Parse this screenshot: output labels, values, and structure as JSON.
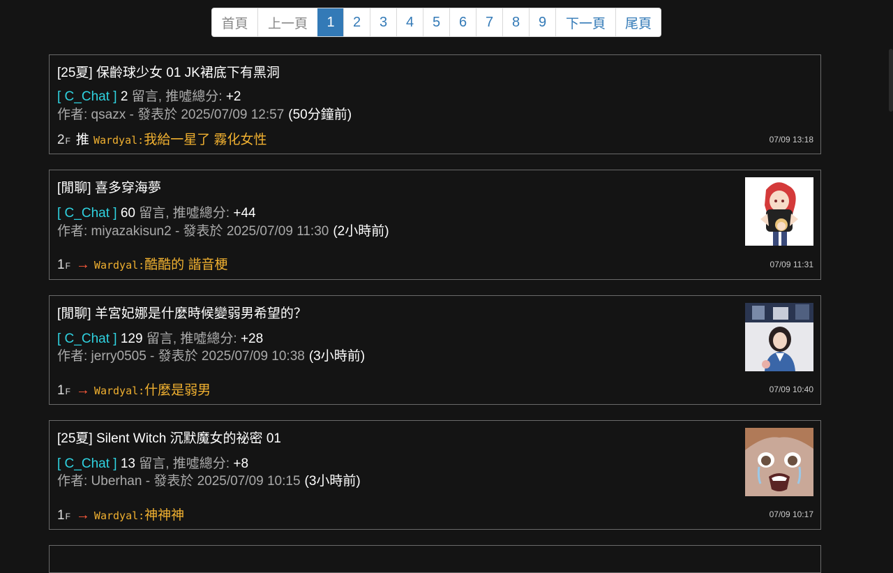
{
  "pagination": {
    "first": "首頁",
    "prev": "上一頁",
    "pages": [
      "1",
      "2",
      "3",
      "4",
      "5",
      "6",
      "7",
      "8",
      "9"
    ],
    "active": "1",
    "next": "下一頁",
    "last": "尾頁"
  },
  "posts": [
    {
      "title": "[25夏] 保齡球少女 01 JK裙底下有黑洞",
      "board": "[ C_Chat ]",
      "comments": "2",
      "comments_label": "留言, 推噓總分:",
      "score": "+2",
      "author_line": "作者: qsazx - 發表於 2025/07/09 12:57",
      "ago": "(50分鐘前)",
      "floor": "2",
      "floor_suffix": "F",
      "push_tag": "推",
      "pusher": "Wardyal:",
      "push_text": "我給一星了 霧化女性",
      "push_time": "07/09 13:18"
    },
    {
      "title": "[閒聊] 喜多穿海夢",
      "board": "[ C_Chat ]",
      "comments": "60",
      "comments_label": "留言, 推噓總分:",
      "score": "+44",
      "author_line": "作者: miyazakisun2 - 發表於 2025/07/09 11:30",
      "ago": "(2小時前)",
      "floor": "1",
      "floor_suffix": "F",
      "push_tag": "→",
      "pusher": "Wardyal:",
      "push_text": "酷酷的 諧音梗",
      "push_time": "07/09 11:31"
    },
    {
      "title": "[閒聊] 羊宮妃娜是什麼時候變弱男希望的？",
      "board": "[ C_Chat ]",
      "comments": "129",
      "comments_label": "留言, 推噓總分:",
      "score": "+28",
      "author_line": "作者: jerry0505 - 發表於 2025/07/09 10:38",
      "ago": "(3小時前)",
      "floor": "1",
      "floor_suffix": "F",
      "push_tag": "→",
      "pusher": "Wardyal:",
      "push_text": "什麼是弱男",
      "push_time": "07/09 10:40"
    },
    {
      "title": "[25夏] Silent Witch 沉默魔女的祕密 01",
      "board": "[ C_Chat ]",
      "comments": "13",
      "comments_label": "留言, 推噓總分:",
      "score": "+8",
      "author_line": "作者: Uberhan - 發表於 2025/07/09 10:15",
      "ago": "(3小時前)",
      "floor": "1",
      "floor_suffix": "F",
      "push_tag": "→",
      "pusher": "Wardyal:",
      "push_text": "神神神",
      "push_time": "07/09 10:17"
    }
  ],
  "colors": {
    "board": "#2fd2e0",
    "push_text": "#f0b030",
    "arrow": "#ff5a3c",
    "pagination_active": "#337ab7"
  }
}
